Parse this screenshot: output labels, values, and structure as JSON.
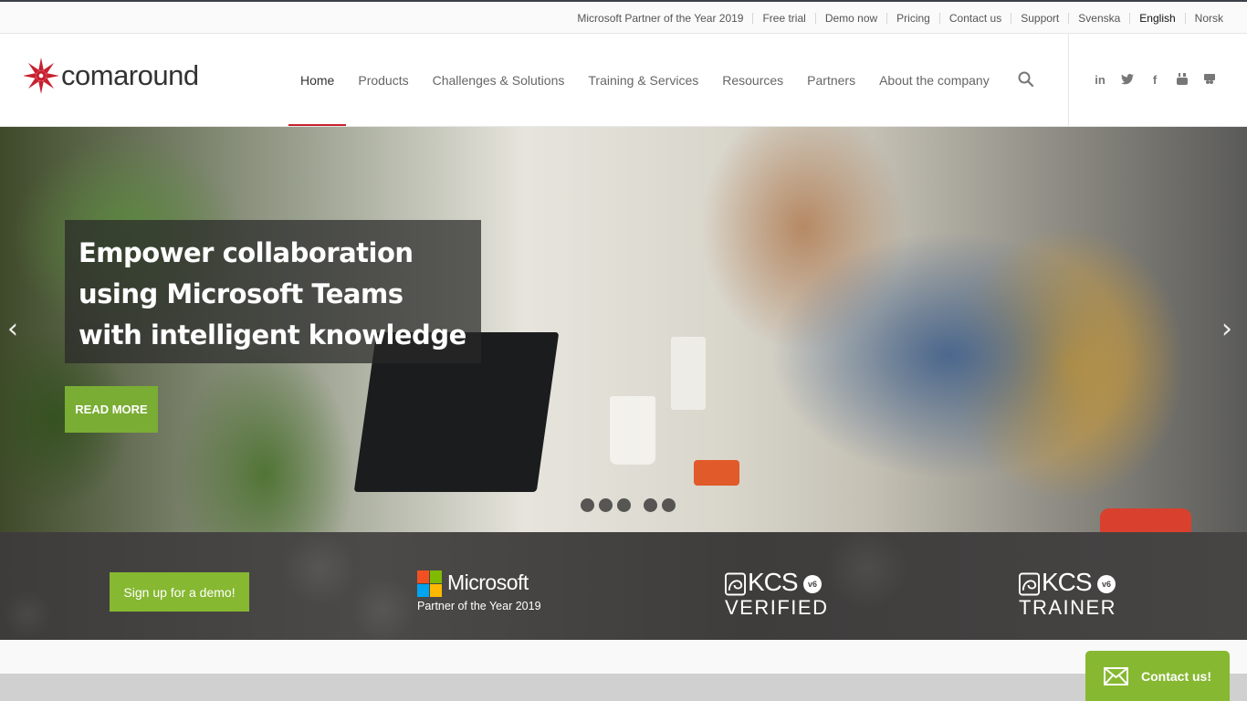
{
  "topbar": {
    "links": [
      {
        "label": "Microsoft Partner of the Year 2019"
      },
      {
        "label": "Free trial"
      },
      {
        "label": "Demo now"
      },
      {
        "label": "Pricing"
      },
      {
        "label": "Contact us"
      },
      {
        "label": "Support"
      },
      {
        "label": "Svenska"
      },
      {
        "label": "English",
        "active": true
      },
      {
        "label": "Norsk"
      }
    ]
  },
  "header": {
    "logo_text": "comaround",
    "brand_color": "#c8202f",
    "nav": [
      {
        "label": "Home",
        "current": true
      },
      {
        "label": "Products"
      },
      {
        "label": "Challenges & Solutions"
      },
      {
        "label": "Training & Services"
      },
      {
        "label": "Resources"
      },
      {
        "label": "Partners"
      },
      {
        "label": "About the company"
      }
    ],
    "search_icon": "search-icon",
    "social": [
      {
        "name": "linkedin-icon",
        "glyph": "in"
      },
      {
        "name": "twitter-icon",
        "glyph": "🐦"
      },
      {
        "name": "facebook-icon",
        "glyph": "f"
      },
      {
        "name": "youtube-icon",
        "glyph": "▶"
      },
      {
        "name": "slideshare-icon",
        "glyph": "◙"
      }
    ]
  },
  "hero": {
    "headline": "Empower collaboration using Microsoft Teams with intelligent knowledge",
    "cta_label": "READ MORE",
    "accent_color": "#7aad34",
    "prev_glyph": "‹",
    "next_glyph": "›",
    "slide_count": 5
  },
  "strip": {
    "demo_label": "Sign up for a demo!",
    "microsoft": {
      "name": "Microsoft",
      "subtitle": "Partner of the Year 2019"
    },
    "kcs_verified": {
      "word": "KCS",
      "badge": "v6",
      "subtitle": "VERIFIED"
    },
    "kcs_trainer": {
      "word": "KCS",
      "badge": "v6",
      "subtitle": "TRAINER"
    }
  },
  "contact": {
    "label": "Contact us!",
    "icon": "envelope-icon",
    "color": "#86b831"
  }
}
